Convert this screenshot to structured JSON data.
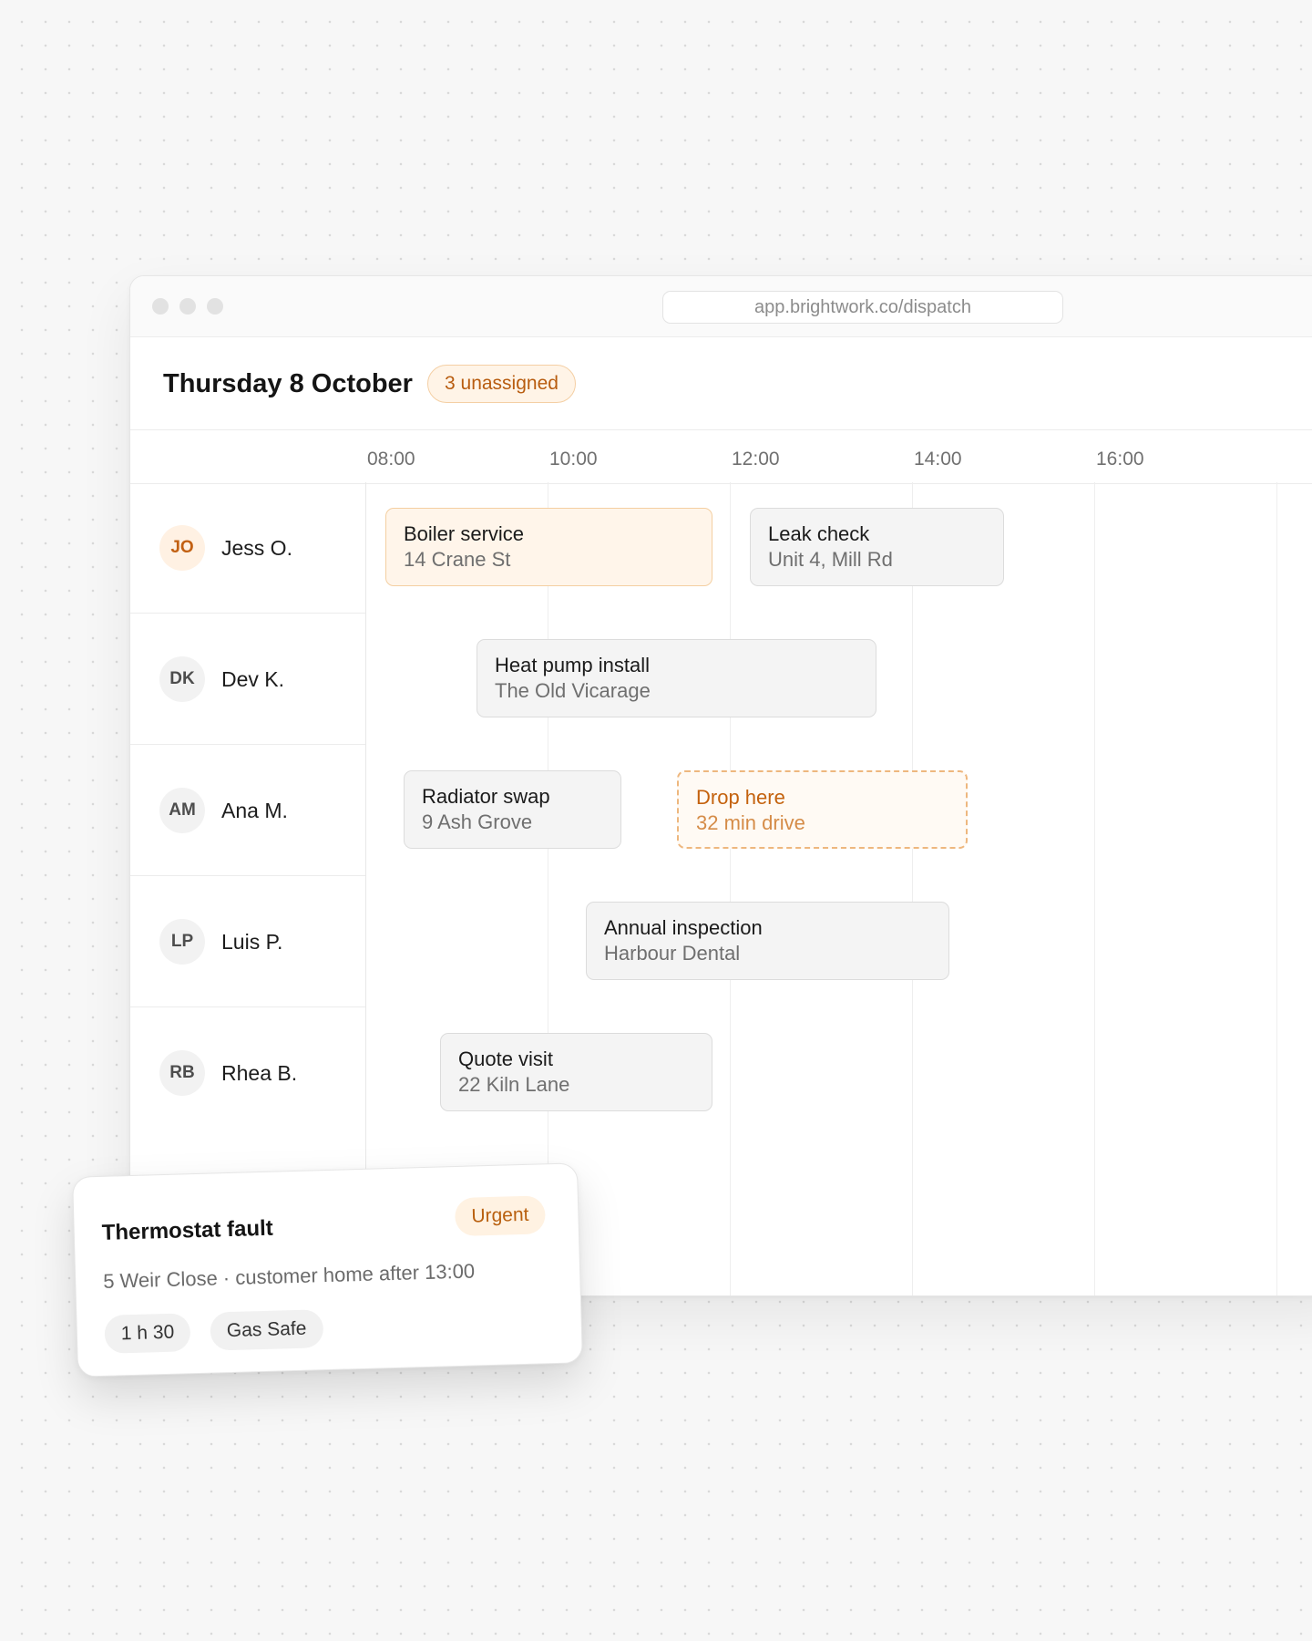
{
  "window": {
    "url": "app.brightwork.co/dispatch"
  },
  "header": {
    "title": "Thursday 8 October",
    "unassigned_badge": "3 unassigned"
  },
  "timeline": {
    "ticks": [
      "08:00",
      "10:00",
      "12:00",
      "14:00",
      "16:00"
    ]
  },
  "technicians": [
    {
      "initials": "JO",
      "name": "Jess O.",
      "highlight": true
    },
    {
      "initials": "DK",
      "name": "Dev K.",
      "highlight": false
    },
    {
      "initials": "AM",
      "name": "Ana M.",
      "highlight": false
    },
    {
      "initials": "LP",
      "name": "Luis P.",
      "highlight": false
    },
    {
      "initials": "RB",
      "name": "Rhea B.",
      "highlight": false
    }
  ],
  "jobs": [
    {
      "title": "Boiler service",
      "address": "14 Crane St",
      "style": "warm"
    },
    {
      "title": "Leak check",
      "address": "Unit 4, Mill Rd",
      "style": "default"
    },
    {
      "title": "Heat pump install",
      "address": "The Old Vicarage",
      "style": "default"
    },
    {
      "title": "Radiator swap",
      "address": "9 Ash Grove",
      "style": "default"
    },
    {
      "title": "Drop here",
      "address": "32 min drive",
      "style": "drop-target"
    },
    {
      "title": "Annual inspection",
      "address": "Harbour Dental",
      "style": "default"
    },
    {
      "title": "Quote visit",
      "address": "22 Kiln Lane",
      "style": "default"
    }
  ],
  "drag_card": {
    "title": "Thermostat fault",
    "priority": "Urgent",
    "details": "5 Weir Close · customer home after 13:00",
    "duration": "1 h 30",
    "skill": "Gas Safe"
  },
  "colors": {
    "accent": "#b85c0f",
    "accent_bg": "#fff4e7",
    "job_bg": "#f4f4f4"
  }
}
